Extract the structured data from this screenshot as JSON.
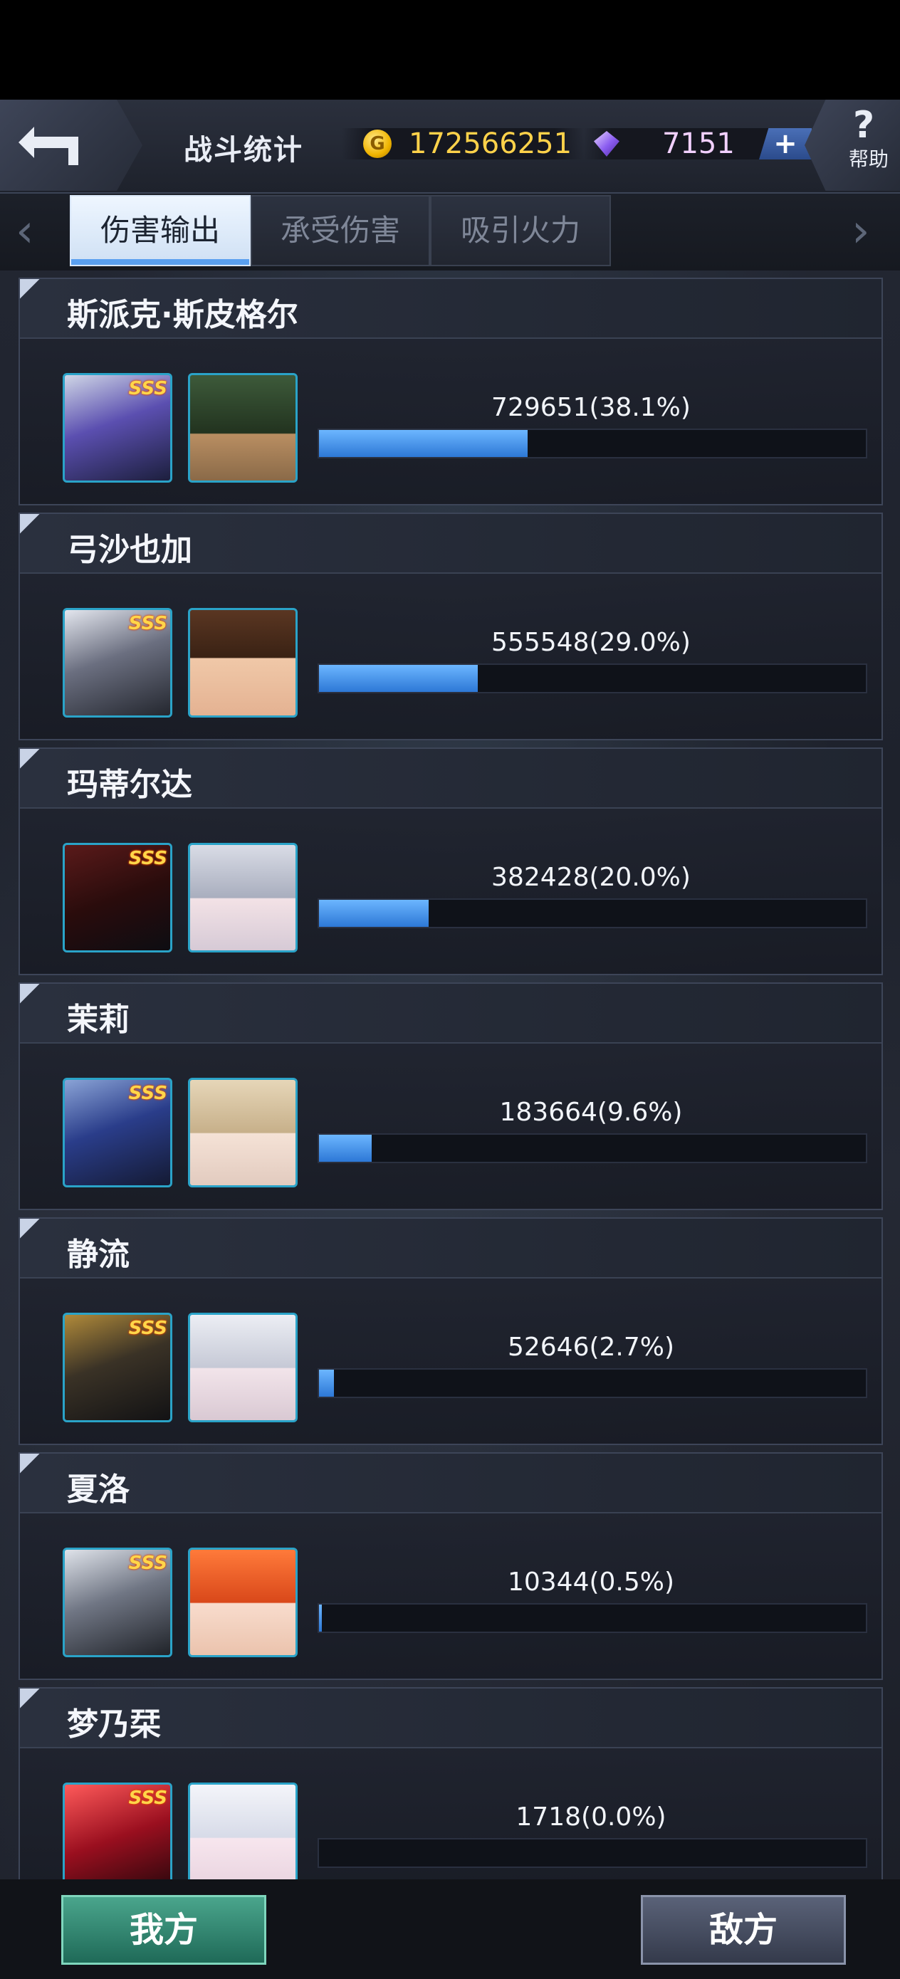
{
  "header": {
    "title": "战斗统计",
    "gold": "172566251",
    "gems": "7151",
    "plus_label": "+",
    "help_label": "帮助",
    "help_symbol": "?"
  },
  "tabs": [
    {
      "label": "伤害输出",
      "active": true
    },
    {
      "label": "承受伤害",
      "active": false
    },
    {
      "label": "吸引火力",
      "active": false
    }
  ],
  "nav": {
    "left_arrow": "‹",
    "right_arrow": "›"
  },
  "pilots": [
    {
      "name": "斯派克·斯皮格尔",
      "stat": "729651(38.1%)",
      "percent": 38.1,
      "rank": "SSS"
    },
    {
      "name": "弓沙也加",
      "stat": "555548(29.0%)",
      "percent": 29.0,
      "rank": "SSS"
    },
    {
      "name": "玛蒂尔达",
      "stat": "382428(20.0%)",
      "percent": 20.0,
      "rank": "SSS"
    },
    {
      "name": "茉莉",
      "stat": "183664(9.6%)",
      "percent": 9.6,
      "rank": "SSS"
    },
    {
      "name": "静流",
      "stat": "52646(2.7%)",
      "percent": 2.7,
      "rank": "SSS"
    },
    {
      "name": "夏洛",
      "stat": "10344(0.5%)",
      "percent": 0.5,
      "rank": "SSS"
    },
    {
      "name": "梦乃栞",
      "stat": "1718(0.0%)",
      "percent": 0.0,
      "rank": "SSS"
    }
  ],
  "bottom": {
    "my_side": "我方",
    "enemy_side": "敌方"
  },
  "colors": {
    "accent": "#2d78d6",
    "gold": "#ffd24a",
    "gem": "#f2d0ff"
  }
}
